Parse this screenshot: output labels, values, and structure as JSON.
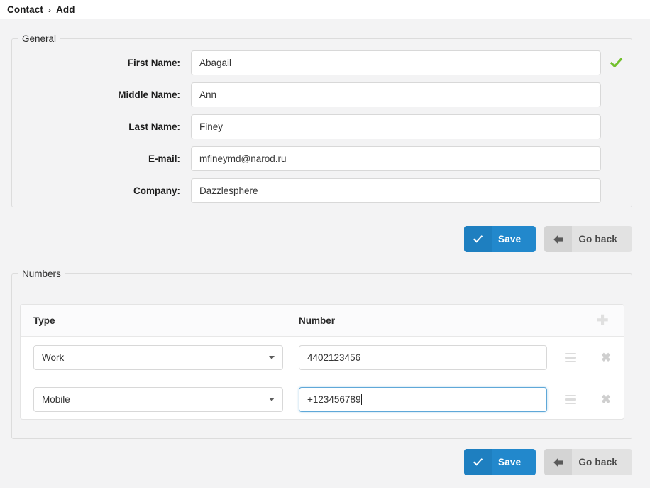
{
  "tab": {
    "root_label": "Contact",
    "separator": "›",
    "leaf_label": "Add"
  },
  "general": {
    "legend": "General",
    "valid_icon": "check-icon",
    "fields": [
      {
        "label": "First Name:",
        "value": "Abagail",
        "placeholder": "",
        "valid": true
      },
      {
        "label": "Middle Name:",
        "value": "Ann",
        "placeholder": "",
        "valid": false
      },
      {
        "label": "Last Name:",
        "value": "Finey",
        "placeholder": "",
        "valid": false
      },
      {
        "label": "E-mail:",
        "value": "mfineymd@narod.ru",
        "placeholder": "",
        "valid": false
      },
      {
        "label": "Company:",
        "value": "Dazzlesphere",
        "placeholder": "",
        "valid": false
      }
    ]
  },
  "actions": {
    "save_label": "Save",
    "save_icon": "check-icon",
    "back_label": "Go back",
    "back_icon": "arrow-left-icon"
  },
  "numbers": {
    "legend": "Numbers",
    "columns": {
      "type": "Type",
      "number": "Number"
    },
    "add_icon": "plus-icon",
    "drag_icon": "drag-handle-icon",
    "delete_icon": "close-icon",
    "rows": [
      {
        "type": "Work",
        "number": "4402123456",
        "number_placeholder": "",
        "focused": false
      },
      {
        "type": "Mobile",
        "number": "+123456789",
        "number_placeholder": "",
        "focused": true
      }
    ]
  },
  "colors": {
    "primary": "#2288cc",
    "primary_icon": "#1e7fc0",
    "default_btn": "#e2e2e2",
    "valid_green": "#72c02c",
    "page_bg": "#f3f3f4",
    "focus_border": "#5fa8d8"
  }
}
